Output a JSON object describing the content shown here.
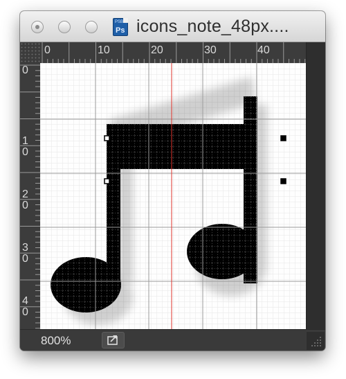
{
  "window": {
    "title": "icons_note_48px....",
    "file_icon": {
      "name": "photoshop-file-icon",
      "tag": "PSB",
      "label": "Ps"
    }
  },
  "rulers": {
    "top_labels": [
      "0",
      "10",
      "20",
      "30",
      "40"
    ],
    "left_labels": [
      [
        "0"
      ],
      [
        "1",
        "0"
      ],
      [
        "2",
        "0"
      ],
      [
        "3",
        "0"
      ],
      [
        "4",
        "0"
      ]
    ]
  },
  "status": {
    "zoom": "800%"
  },
  "colors": {
    "guide": "#e0342c",
    "pixel_grid": "#e6e6e6",
    "major_grid": "#9a9a9a",
    "note_fill": "#000000"
  }
}
